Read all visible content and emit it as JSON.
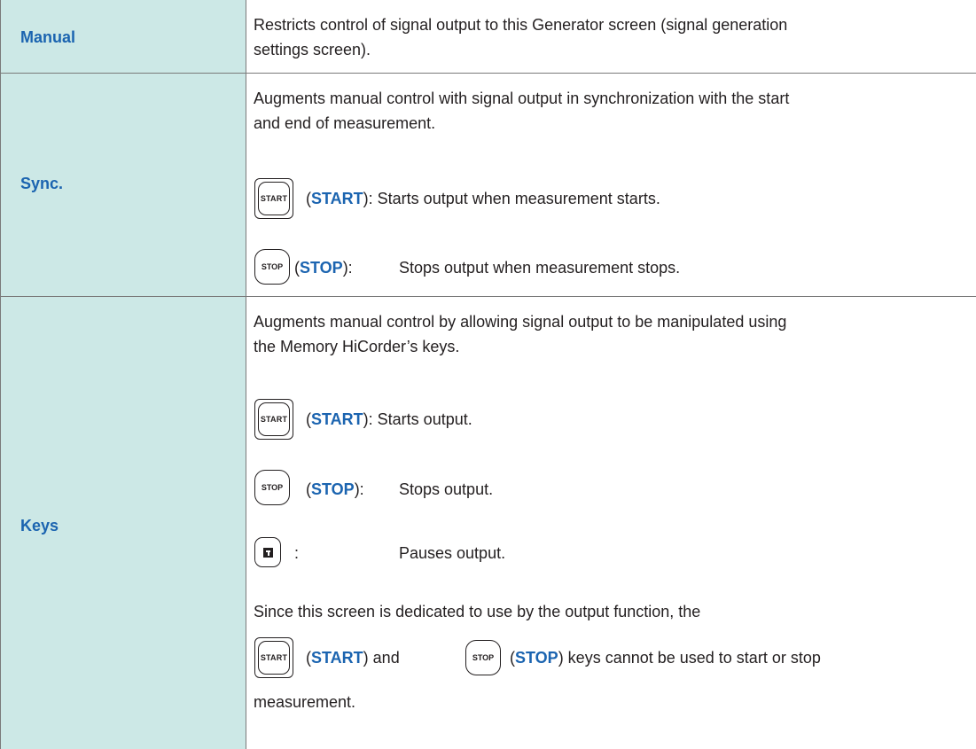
{
  "rows": {
    "manual": {
      "label": "Manual",
      "description": "Restricts control of signal output to this Generator screen (signal generation",
      "description_cont": "settings screen)."
    },
    "sync": {
      "label": "Sync.",
      "intro_1": "Augments manual control with signal output in synchronization with the start",
      "intro_2": "and end of measurement.",
      "start_key": "START",
      "start_open": "(",
      "start_name": "START",
      "start_text": "): Starts output when measurement starts.",
      "stop_key": "STOP",
      "stop_open": "(",
      "stop_name": "STOP",
      "stop_close": "):",
      "stop_text": "Stops output when measurement stops."
    },
    "keys": {
      "label": "Keys",
      "intro_1": "Augments manual control by allowing signal output to be manipulated using",
      "intro_2": "the Memory HiCorder’s keys.",
      "start_key": "START",
      "start_open": "(",
      "start_name": "START",
      "start_text": "): Starts output.",
      "stop_key": "STOP",
      "stop_open": "(",
      "stop_name": "STOP",
      "stop_close": "):",
      "stop_text": "Stops output.",
      "pause_colon": ":",
      "pause_text": "Pauses output.",
      "note_1": "Since this screen is dedicated to use by the output function, the",
      "note_start_key": "START",
      "note_start_open": "(",
      "note_start_name": "START",
      "note_and": ") and",
      "note_stop_key": "STOP",
      "note_stop_open": "(",
      "note_stop_name": "STOP",
      "note_tail": ") keys cannot be used to start or stop",
      "note_3": "measurement."
    }
  },
  "colors": {
    "label_background": "#cce8e6",
    "label_text": "#1b64b0",
    "border": "#7a7a7a"
  },
  "icons": [
    "start-key-icon",
    "stop-key-icon",
    "pause-key-icon"
  ]
}
